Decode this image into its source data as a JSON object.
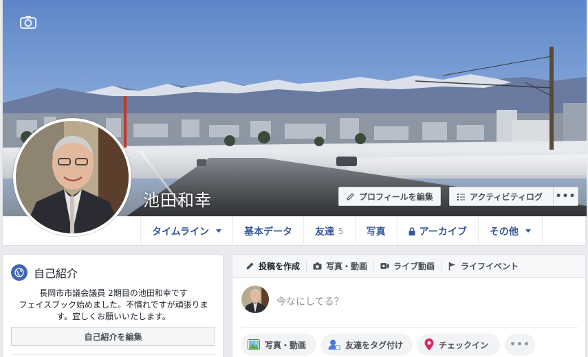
{
  "profile": {
    "name": "池田和幸",
    "edit_profile_label": "プロフィールを編集",
    "activity_log_label": "アクティビティログ",
    "more_label": "•••"
  },
  "nav": {
    "items": [
      {
        "label": "タイムライン"
      },
      {
        "label": "基本データ"
      },
      {
        "label": "友達",
        "count": "5"
      },
      {
        "label": "写真"
      },
      {
        "label": "アーカイブ"
      },
      {
        "label": "その他"
      }
    ]
  },
  "intro": {
    "title": "自己紹介",
    "bio_lines": [
      "長岡市市議会議員 2期目の池田和幸です",
      "フェイスブック始めました。不慣れですが頑張りま",
      "す。宜しくお願いいたします。"
    ],
    "edit_label": "自己紹介を編集"
  },
  "composer": {
    "tabs": [
      {
        "label": "投稿を作成",
        "icon": "pencil-icon"
      },
      {
        "label": "写真・動画",
        "icon": "camera-icon"
      },
      {
        "label": "ライブ動画",
        "icon": "live-video-icon"
      },
      {
        "label": "ライフイベント",
        "icon": "flag-icon"
      }
    ],
    "placeholder": "今なにしてる？",
    "chips": [
      {
        "label": "写真・動画",
        "icon": "photo-icon"
      },
      {
        "label": "友達をタグ付け",
        "icon": "tag-friends-icon"
      },
      {
        "label": "チェックイン",
        "icon": "location-pin-icon"
      }
    ],
    "more_label": "•••"
  },
  "colors": {
    "link_blue": "#365899",
    "brand_blue": "#4267b2",
    "page_bg": "#e9ebee"
  }
}
